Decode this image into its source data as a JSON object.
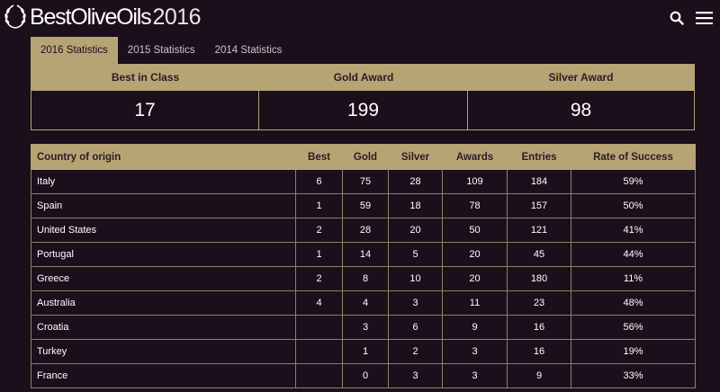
{
  "header": {
    "brand": "BestOliveOils",
    "year": "2016",
    "icons": [
      "laurel-wreath-logo-icon",
      "search-icon",
      "hamburger-menu-icon"
    ]
  },
  "tabs": [
    {
      "label": "2016 Statistics",
      "active": true
    },
    {
      "label": "2015 Statistics",
      "active": false
    },
    {
      "label": "2014 Statistics",
      "active": false
    }
  ],
  "summary": {
    "best_label": "Best in Class",
    "gold_label": "Gold Award",
    "silver_label": "Silver Award",
    "best_value": "17",
    "gold_value": "199",
    "silver_value": "98"
  },
  "table": {
    "columns": [
      "Country of origin",
      "Best",
      "Gold",
      "Silver",
      "Awards",
      "Entries",
      "Rate of Success"
    ],
    "rows": [
      [
        "Italy",
        "6",
        "75",
        "28",
        "109",
        "184",
        "59%"
      ],
      [
        "Spain",
        "1",
        "59",
        "18",
        "78",
        "157",
        "50%"
      ],
      [
        "United States",
        "2",
        "28",
        "20",
        "50",
        "121",
        "41%"
      ],
      [
        "Portugal",
        "1",
        "14",
        "5",
        "20",
        "45",
        "44%"
      ],
      [
        "Greece",
        "2",
        "8",
        "10",
        "20",
        "180",
        "11%"
      ],
      [
        "Australia",
        "4",
        "4",
        "3",
        "11",
        "23",
        "48%"
      ],
      [
        "Croatia",
        "",
        "3",
        "6",
        "9",
        "16",
        "56%"
      ],
      [
        "Turkey",
        "",
        "1",
        "2",
        "3",
        "16",
        "19%"
      ],
      [
        "France",
        "",
        "0",
        "3",
        "3",
        "9",
        "33%"
      ]
    ]
  },
  "colors": {
    "background": "#1b0f1b",
    "gold_accent": "#b6a474",
    "header_text": "#2a1d24"
  }
}
